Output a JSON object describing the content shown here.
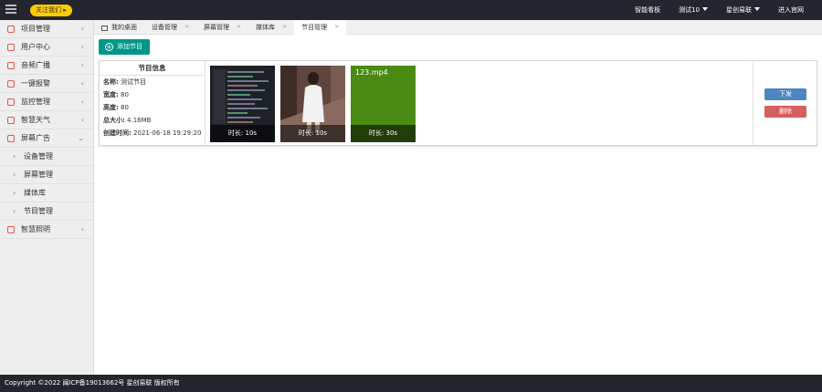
{
  "topbar": {
    "follow": "关注我们 ▸",
    "links": [
      "智能看板",
      "测试10",
      "星创易联",
      "进入官网"
    ]
  },
  "sidebar": {
    "items": [
      {
        "label": "项目管理"
      },
      {
        "label": "用户中心"
      },
      {
        "label": "音频广播"
      },
      {
        "label": "一键报警"
      },
      {
        "label": "监控管理"
      },
      {
        "label": "智慧天气"
      },
      {
        "label": "屏幕广告"
      }
    ],
    "subitems": [
      {
        "label": "设备管理"
      },
      {
        "label": "屏幕管理"
      },
      {
        "label": "媒体库"
      },
      {
        "label": "节目管理"
      }
    ],
    "last": {
      "label": "智慧照明"
    }
  },
  "tabs": [
    "我的桌面",
    "设备管理",
    "屏幕管理",
    "媒体库",
    "节目管理"
  ],
  "content": {
    "add_label": "添加节目",
    "info": {
      "title": "节目信息",
      "name_label": "名称:",
      "name": "测试节目",
      "width_label": "宽度:",
      "width": "80",
      "height_label": "高度:",
      "height": "80",
      "size_label": "总大小:",
      "size": "4.16MB",
      "created_label": "创建时间:",
      "created": "2021-06-18 19:29:20"
    },
    "media": [
      {
        "caption": "时长: 10s"
      },
      {
        "caption": "时长: 10s"
      },
      {
        "filename": "123.mp4",
        "caption": "时长: 30s"
      }
    ],
    "issue_label": "下发",
    "delete_label": "删除"
  },
  "footer": "Copyright ©2022 闽ICP备19013662号 星创易联 版权所有",
  "colors": {
    "primary": "#009688",
    "issue": "#4e86c2",
    "delete": "#d45f5f",
    "dark": "#23262e"
  }
}
